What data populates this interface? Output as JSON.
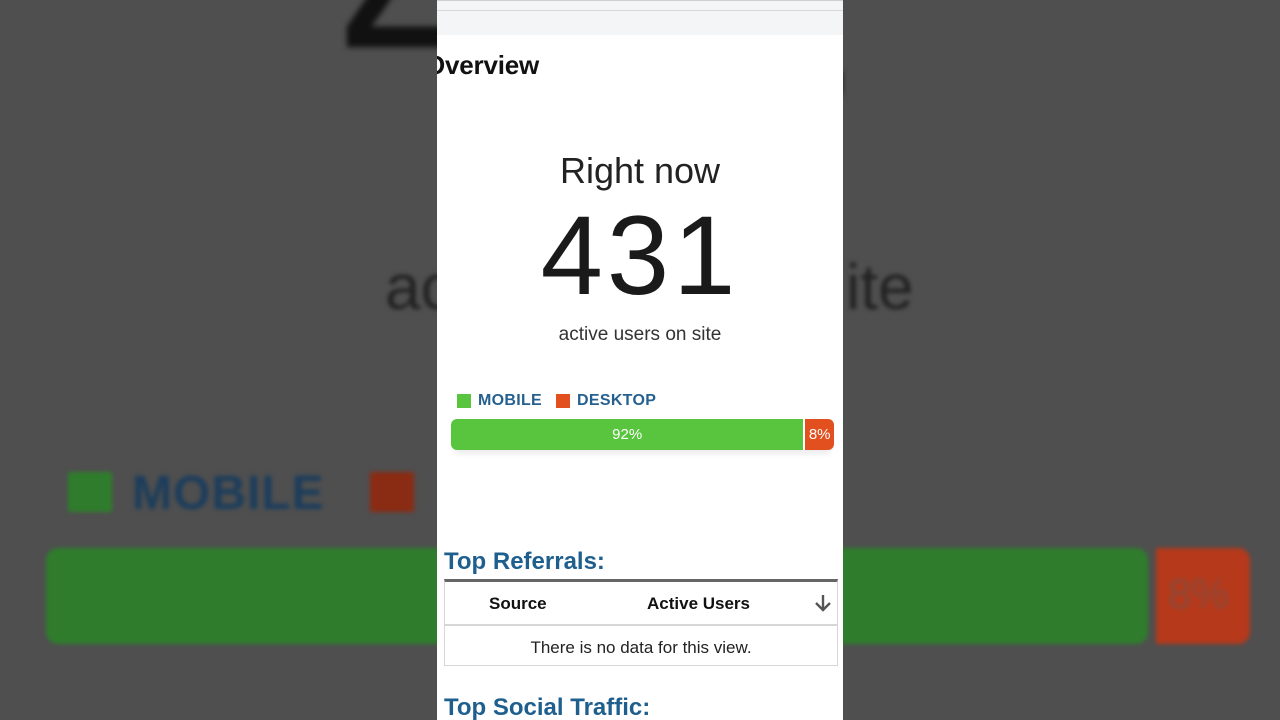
{
  "page": {
    "title": "Overview"
  },
  "realtime": {
    "heading": "Right now",
    "active_users": "431",
    "subtitle": "active users on site"
  },
  "devices": {
    "legend": [
      {
        "label": "MOBILE",
        "color": "#59c43d"
      },
      {
        "label": "DESKTOP",
        "color": "#e3501f"
      }
    ],
    "breakdown": [
      {
        "label": "92%",
        "value": 92,
        "color": "#59c43d"
      },
      {
        "label": "8%",
        "value": 8,
        "color": "#e3501f"
      }
    ]
  },
  "top_referrals": {
    "title": "Top Referrals:",
    "columns": [
      "Source",
      "Active Users"
    ],
    "sort_icon": "arrow-down-icon",
    "empty_message": "There is no data for this view."
  },
  "top_social": {
    "title": "Top Social Traffic:"
  },
  "colors": {
    "accent_blue": "#1e5f8e",
    "mobile_green": "#59c43d",
    "desktop_orange": "#e3501f"
  }
}
